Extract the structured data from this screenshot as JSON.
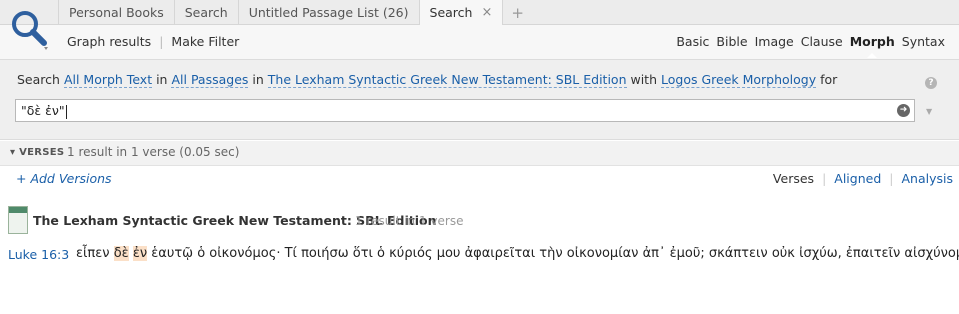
{
  "tabs": [
    {
      "label": "Personal Books"
    },
    {
      "label": "Search"
    },
    {
      "label": "Untitled Passage List (26)"
    },
    {
      "label": "Search",
      "close": "×"
    }
  ],
  "add_tab": "+",
  "toolbar": {
    "left": [
      "Graph results",
      "Make Filter"
    ],
    "modes": [
      "Basic",
      "Bible",
      "Image",
      "Clause",
      "Morph",
      "Syntax"
    ],
    "active_mode": "Morph"
  },
  "search": {
    "w1": "Search",
    "l1": "All Morph Text",
    "w2": "in",
    "l2": "All Passages",
    "w3": "in",
    "l3": "The Lexham Syntactic Greek New Testament: SBL Edition",
    "w4": "with",
    "l4": "Logos Greek Morphology",
    "w5": "for",
    "help": "?",
    "query": "\"δὲ ἐν\"",
    "go": "➜",
    "menu": "▼"
  },
  "verses": {
    "title": "VERSES",
    "stats": "1 result in 1 verse (0.05 sec)"
  },
  "results": {
    "add_versions": "+ Add Versions",
    "view_modes": [
      "Verses",
      "Aligned",
      "Analysis"
    ],
    "book_name": "The Lexham Syntactic Greek New Testament: SBL Edition",
    "book_count": "1 result in 1 verse",
    "reference": "Luke 16:3",
    "verse_pre": "εἶπεν ",
    "verse_hl1": "δὲ",
    "verse_sp": " ",
    "verse_hl2": "ἐν",
    "verse_post": " ἑαυτῷ ὁ οἰκονόμος· Τί ποιήσω ὅτι ὁ κύριός μου ἀφαιρεῖται τὴν οἰκονομίαν ἀπ᾽ ἐμοῦ; σκάπτειν οὐκ ἰσχύω, ἐπαιτεῖν αἰσχύνομαι·"
  },
  "colors": {
    "link": "#1a5fa8",
    "highlight": "#fbe0c8"
  }
}
